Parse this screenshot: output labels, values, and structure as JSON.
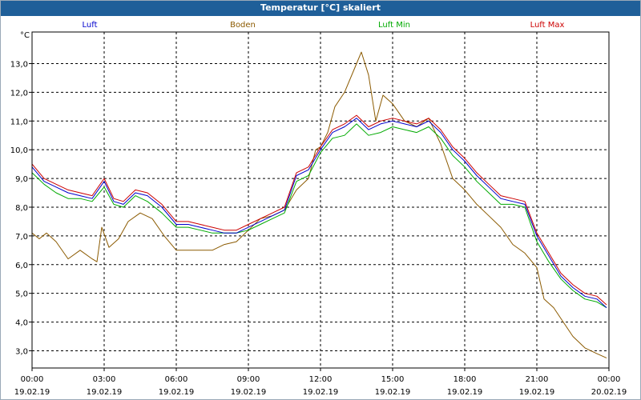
{
  "window": {
    "title": "Temperatur [°C] skaliert"
  },
  "colors": {
    "luft": "#0000cc",
    "boden": "#8b5a00",
    "luft_min": "#00aa00",
    "luft_max": "#cc0000",
    "titlebar": "#1f5f99"
  },
  "chart_data": {
    "type": "line",
    "ylabel": "°C",
    "ylim": [
      2.4,
      14.1
    ],
    "y_ticks": [
      "3,0",
      "4,0",
      "5,0",
      "6,0",
      "7,0",
      "8,0",
      "9,0",
      "10,0",
      "11,0",
      "12,0",
      "13,0"
    ],
    "y_tick_values": [
      3,
      4,
      5,
      6,
      7,
      8,
      9,
      10,
      11,
      12,
      13
    ],
    "xlim": [
      0,
      24
    ],
    "x_ticks": [
      {
        "x": 0,
        "time": "00:00",
        "date": "19.02.19"
      },
      {
        "x": 3,
        "time": "03:00",
        "date": "19.02.19"
      },
      {
        "x": 6,
        "time": "06:00",
        "date": "19.02.19"
      },
      {
        "x": 9,
        "time": "09:00",
        "date": "19.02.19"
      },
      {
        "x": 12,
        "time": "12:00",
        "date": "19.02.19"
      },
      {
        "x": 15,
        "time": "15:00",
        "date": "19.02.19"
      },
      {
        "x": 18,
        "time": "18:00",
        "date": "19.02.19"
      },
      {
        "x": 21,
        "time": "21:00",
        "date": "19.02.19"
      },
      {
        "x": 24,
        "time": "00:00",
        "date": "20.02.19"
      }
    ],
    "grid": true,
    "series": [
      {
        "name": "Luft",
        "color": "#0000cc",
        "points": [
          [
            0,
            9.4
          ],
          [
            0.5,
            8.9
          ],
          [
            1,
            8.7
          ],
          [
            1.5,
            8.5
          ],
          [
            2,
            8.4
          ],
          [
            2.5,
            8.3
          ],
          [
            3,
            8.9
          ],
          [
            3.4,
            8.2
          ],
          [
            3.8,
            8.1
          ],
          [
            4.3,
            8.5
          ],
          [
            4.8,
            8.4
          ],
          [
            5.4,
            8.0
          ],
          [
            6,
            7.4
          ],
          [
            6.5,
            7.4
          ],
          [
            7,
            7.3
          ],
          [
            7.5,
            7.2
          ],
          [
            8,
            7.1
          ],
          [
            8.5,
            7.1
          ],
          [
            9,
            7.3
          ],
          [
            9.5,
            7.5
          ],
          [
            10,
            7.7
          ],
          [
            10.5,
            7.9
          ],
          [
            11,
            9.1
          ],
          [
            11.5,
            9.3
          ],
          [
            12,
            10.0
          ],
          [
            12.5,
            10.6
          ],
          [
            13,
            10.8
          ],
          [
            13.5,
            11.1
          ],
          [
            14,
            10.7
          ],
          [
            14.5,
            10.9
          ],
          [
            15,
            11.0
          ],
          [
            15.5,
            10.9
          ],
          [
            16,
            10.8
          ],
          [
            16.5,
            11.0
          ],
          [
            17,
            10.6
          ],
          [
            17.5,
            10.0
          ],
          [
            18,
            9.6
          ],
          [
            18.5,
            9.1
          ],
          [
            19,
            8.7
          ],
          [
            19.5,
            8.3
          ],
          [
            20,
            8.2
          ],
          [
            20.5,
            8.1
          ],
          [
            21,
            7.0
          ],
          [
            21.5,
            6.3
          ],
          [
            22,
            5.6
          ],
          [
            22.5,
            5.2
          ],
          [
            23,
            4.9
          ],
          [
            23.5,
            4.8
          ],
          [
            23.9,
            4.5
          ]
        ]
      },
      {
        "name": "Boden",
        "color": "#8b5a00",
        "points": [
          [
            0,
            7.1
          ],
          [
            0.3,
            6.9
          ],
          [
            0.6,
            7.1
          ],
          [
            1,
            6.8
          ],
          [
            1.5,
            6.2
          ],
          [
            2,
            6.5
          ],
          [
            2.5,
            6.2
          ],
          [
            2.7,
            6.1
          ],
          [
            2.9,
            7.3
          ],
          [
            3.2,
            6.6
          ],
          [
            3.6,
            6.9
          ],
          [
            4,
            7.5
          ],
          [
            4.5,
            7.8
          ],
          [
            5,
            7.6
          ],
          [
            5.5,
            7.0
          ],
          [
            6,
            6.5
          ],
          [
            6.5,
            6.5
          ],
          [
            7,
            6.5
          ],
          [
            7.5,
            6.5
          ],
          [
            8,
            6.7
          ],
          [
            8.5,
            6.8
          ],
          [
            9,
            7.2
          ],
          [
            9.5,
            7.6
          ],
          [
            10,
            7.7
          ],
          [
            10.5,
            7.9
          ],
          [
            11,
            8.6
          ],
          [
            11.5,
            9.0
          ],
          [
            11.8,
            10.0
          ],
          [
            12,
            10.1
          ],
          [
            12.3,
            10.6
          ],
          [
            12.6,
            11.5
          ],
          [
            13,
            12.0
          ],
          [
            13.5,
            13.0
          ],
          [
            13.7,
            13.4
          ],
          [
            14,
            12.6
          ],
          [
            14.3,
            11.0
          ],
          [
            14.6,
            11.9
          ],
          [
            15,
            11.6
          ],
          [
            15.5,
            11.0
          ],
          [
            16,
            10.8
          ],
          [
            16.5,
            11.1
          ],
          [
            17,
            10.2
          ],
          [
            17.5,
            9.0
          ],
          [
            18,
            8.6
          ],
          [
            18.5,
            8.1
          ],
          [
            19,
            7.7
          ],
          [
            19.5,
            7.3
          ],
          [
            20,
            6.7
          ],
          [
            20.5,
            6.4
          ],
          [
            21,
            5.9
          ],
          [
            21.3,
            4.8
          ],
          [
            21.7,
            4.5
          ],
          [
            22.1,
            4.0
          ],
          [
            22.5,
            3.5
          ],
          [
            23,
            3.1
          ],
          [
            23.5,
            2.9
          ],
          [
            23.9,
            2.75
          ]
        ]
      },
      {
        "name": "Luft Min",
        "color": "#00aa00",
        "points": [
          [
            0,
            9.2
          ],
          [
            0.5,
            8.8
          ],
          [
            1,
            8.5
          ],
          [
            1.5,
            8.3
          ],
          [
            2,
            8.3
          ],
          [
            2.5,
            8.2
          ],
          [
            3,
            8.7
          ],
          [
            3.4,
            8.1
          ],
          [
            3.8,
            8.0
          ],
          [
            4.3,
            8.4
          ],
          [
            4.8,
            8.2
          ],
          [
            5.4,
            7.8
          ],
          [
            6,
            7.3
          ],
          [
            6.5,
            7.3
          ],
          [
            7,
            7.2
          ],
          [
            7.5,
            7.1
          ],
          [
            8,
            7.1
          ],
          [
            8.5,
            7.1
          ],
          [
            9,
            7.2
          ],
          [
            9.5,
            7.4
          ],
          [
            10,
            7.6
          ],
          [
            10.5,
            7.8
          ],
          [
            11,
            8.9
          ],
          [
            11.5,
            9.1
          ],
          [
            12,
            9.9
          ],
          [
            12.5,
            10.4
          ],
          [
            13,
            10.5
          ],
          [
            13.5,
            10.9
          ],
          [
            14,
            10.5
          ],
          [
            14.5,
            10.6
          ],
          [
            15,
            10.8
          ],
          [
            15.5,
            10.7
          ],
          [
            16,
            10.6
          ],
          [
            16.5,
            10.8
          ],
          [
            17,
            10.4
          ],
          [
            17.5,
            9.8
          ],
          [
            18,
            9.4
          ],
          [
            18.5,
            8.9
          ],
          [
            19,
            8.5
          ],
          [
            19.5,
            8.1
          ],
          [
            20,
            8.1
          ],
          [
            20.5,
            8.0
          ],
          [
            21,
            6.8
          ],
          [
            21.5,
            6.1
          ],
          [
            22,
            5.5
          ],
          [
            22.5,
            5.1
          ],
          [
            23,
            4.8
          ],
          [
            23.5,
            4.7
          ],
          [
            23.9,
            4.5
          ]
        ]
      },
      {
        "name": "Luft Max",
        "color": "#cc0000",
        "points": [
          [
            0,
            9.5
          ],
          [
            0.5,
            9.0
          ],
          [
            1,
            8.8
          ],
          [
            1.5,
            8.6
          ],
          [
            2,
            8.5
          ],
          [
            2.5,
            8.4
          ],
          [
            3,
            9.0
          ],
          [
            3.4,
            8.3
          ],
          [
            3.8,
            8.2
          ],
          [
            4.3,
            8.6
          ],
          [
            4.8,
            8.5
          ],
          [
            5.4,
            8.1
          ],
          [
            6,
            7.5
          ],
          [
            6.5,
            7.5
          ],
          [
            7,
            7.4
          ],
          [
            7.5,
            7.3
          ],
          [
            8,
            7.2
          ],
          [
            8.5,
            7.2
          ],
          [
            9,
            7.4
          ],
          [
            9.5,
            7.6
          ],
          [
            10,
            7.8
          ],
          [
            10.5,
            8.0
          ],
          [
            11,
            9.2
          ],
          [
            11.5,
            9.4
          ],
          [
            12,
            10.1
          ],
          [
            12.5,
            10.7
          ],
          [
            13,
            10.9
          ],
          [
            13.5,
            11.2
          ],
          [
            14,
            10.8
          ],
          [
            14.5,
            11.0
          ],
          [
            15,
            11.1
          ],
          [
            15.5,
            11.0
          ],
          [
            16,
            10.9
          ],
          [
            16.5,
            11.1
          ],
          [
            17,
            10.7
          ],
          [
            17.5,
            10.1
          ],
          [
            18,
            9.7
          ],
          [
            18.5,
            9.2
          ],
          [
            19,
            8.8
          ],
          [
            19.5,
            8.4
          ],
          [
            20,
            8.3
          ],
          [
            20.5,
            8.2
          ],
          [
            21,
            7.1
          ],
          [
            21.5,
            6.4
          ],
          [
            22,
            5.7
          ],
          [
            22.5,
            5.3
          ],
          [
            23,
            5.0
          ],
          [
            23.5,
            4.9
          ],
          [
            23.9,
            4.6
          ]
        ]
      }
    ]
  }
}
